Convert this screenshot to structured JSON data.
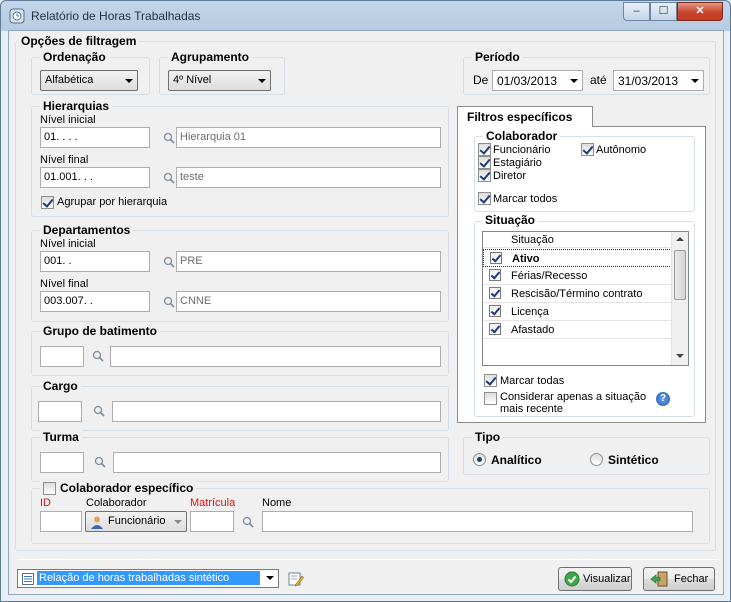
{
  "window": {
    "title": "Relatório de Horas Trabalhadas",
    "min_glyph": "‒",
    "max_glyph": "☐",
    "close_glyph": "✕"
  },
  "filters": {
    "title": "Opções de filtragem",
    "ordenacao": {
      "label": "Ordenação",
      "value": "Alfabética"
    },
    "agrupamento": {
      "label": "Agrupamento",
      "value": "4º Nível"
    },
    "periodo": {
      "label": "Período",
      "de_label": "De",
      "start": "01/03/2013",
      "ate_label": "até",
      "end": "31/03/2013"
    },
    "hierarquias": {
      "label": "Hierarquias",
      "nivel_inicial_label": "Nível inicial",
      "nivel_inicial_code": "01.   .   .   .",
      "nivel_inicial_desc": "Hierarquia 01",
      "nivel_final_label": "Nível final",
      "nivel_final_code": "01.001.   .   .",
      "nivel_final_desc": "teste",
      "agrupar_label": "Agrupar por hierarquia"
    },
    "departamentos": {
      "label": "Departamentos",
      "nivel_inicial_label": "Nível inicial",
      "nivel_inicial_code": "001.   .",
      "nivel_inicial_desc": "PRE",
      "nivel_final_label": "Nível final",
      "nivel_final_code": "003.007.   .",
      "nivel_final_desc": "CNNE"
    },
    "grupo_batimento": {
      "label": "Grupo de batimento"
    },
    "cargo": {
      "label": "Cargo"
    },
    "turma": {
      "label": "Turma"
    },
    "colaborador_especifico": {
      "label": "Colaborador específico",
      "id_label": "ID",
      "colaborador_label": "Colaborador",
      "colaborador_value": "Funcionário",
      "matricula_label": "Matrícula",
      "nome_label": "Nome"
    }
  },
  "filtros_especificos": {
    "tab_label": "Filtros específicos",
    "colaborador": {
      "label": "Colaborador",
      "funcionario": "Funcionário",
      "autonomo": "Autônomo",
      "estagiario": "Estagiário",
      "diretor": "Diretor",
      "marcar_todos": "Marcar todos"
    },
    "situacao": {
      "label": "Situação",
      "column_header": "Situação",
      "rows": [
        "Ativo",
        "Férias/Recesso",
        "Rescisão/Término contrato",
        "Licença",
        "Afastado"
      ],
      "marcar_todas": "Marcar todas",
      "considerar_line1": "Considerar apenas a situação",
      "considerar_line2": "mais recente",
      "help_glyph": "?"
    }
  },
  "tipo": {
    "label": "Tipo",
    "analitico": "Analítico",
    "sintetico": "Sintético",
    "selected": "Analítico"
  },
  "footer": {
    "report_select": "Relação de horas trabalhadas sintético",
    "visualizar_label": "Visualizar",
    "fechar_label": "Fechar"
  }
}
